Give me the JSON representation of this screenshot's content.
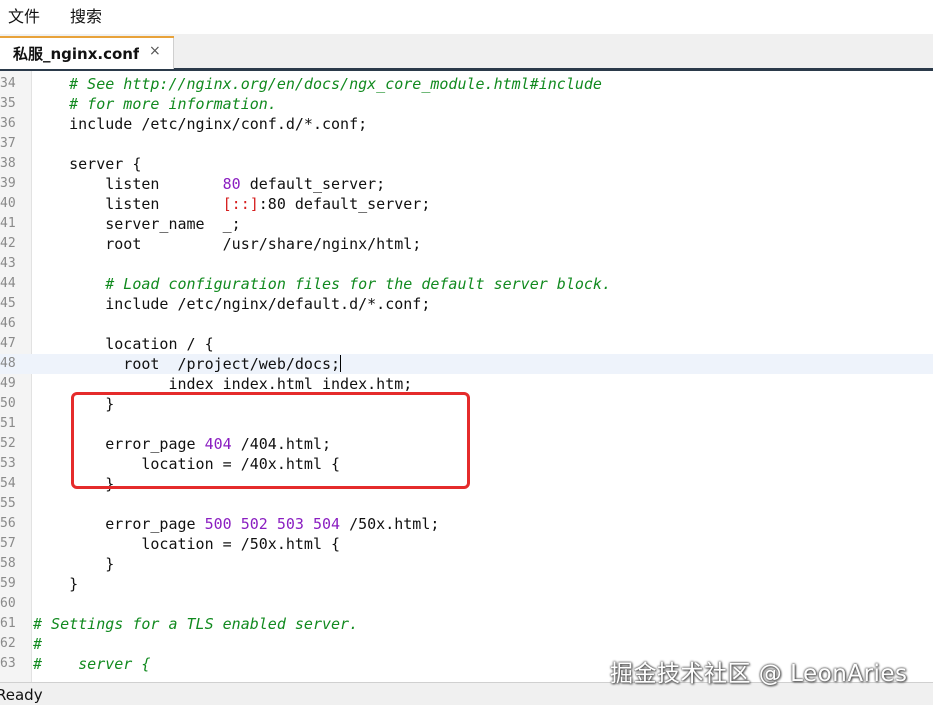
{
  "menubar": {
    "items": [
      "文件",
      "搜索"
    ]
  },
  "tabs": [
    {
      "label": "私服_nginx.conf",
      "close": "×"
    }
  ],
  "editor": {
    "lines": [
      {
        "n": "34",
        "segs": [
          {
            "t": "    "
          },
          {
            "t": "# See http://nginx.org/en/docs/ngx_core_module.html#include",
            "c": "cmt"
          }
        ]
      },
      {
        "n": "35",
        "segs": [
          {
            "t": "    "
          },
          {
            "t": "# for more information.",
            "c": "cmt"
          }
        ]
      },
      {
        "n": "36",
        "segs": [
          {
            "t": "    include /etc/nginx/conf.d/*.conf;"
          }
        ]
      },
      {
        "n": "37",
        "segs": []
      },
      {
        "n": "38",
        "segs": [
          {
            "t": "    server {"
          }
        ]
      },
      {
        "n": "39",
        "segs": [
          {
            "t": "        listen       "
          },
          {
            "t": "80",
            "c": "num"
          },
          {
            "t": " default_server;"
          }
        ]
      },
      {
        "n": "40",
        "segs": [
          {
            "t": "        listen       "
          },
          {
            "t": "[::]",
            "c": "br"
          },
          {
            "t": ":80 default_server;"
          }
        ]
      },
      {
        "n": "41",
        "segs": [
          {
            "t": "        server_name  _;"
          }
        ]
      },
      {
        "n": "42",
        "segs": [
          {
            "t": "        root         /usr/share/nginx/html;"
          }
        ]
      },
      {
        "n": "43",
        "segs": []
      },
      {
        "n": "44",
        "segs": [
          {
            "t": "        "
          },
          {
            "t": "# Load configuration files for the default server block.",
            "c": "cmt"
          }
        ]
      },
      {
        "n": "45",
        "segs": [
          {
            "t": "        include /etc/nginx/default.d/*.conf;"
          }
        ]
      },
      {
        "n": "46",
        "segs": []
      },
      {
        "n": "47",
        "segs": [
          {
            "t": "        location / {"
          }
        ]
      },
      {
        "n": "48",
        "current": true,
        "caret": true,
        "segs": [
          {
            "t": "          root  /project/web/docs;"
          }
        ]
      },
      {
        "n": "49",
        "segs": [
          {
            "t": "               index index.html index.htm;"
          }
        ]
      },
      {
        "n": "50",
        "segs": [
          {
            "t": "        }"
          }
        ]
      },
      {
        "n": "51",
        "segs": []
      },
      {
        "n": "52",
        "segs": [
          {
            "t": "        error_page "
          },
          {
            "t": "404",
            "c": "num"
          },
          {
            "t": " /404.html;"
          }
        ]
      },
      {
        "n": "53",
        "segs": [
          {
            "t": "            location = /40x.html {"
          }
        ]
      },
      {
        "n": "54",
        "segs": [
          {
            "t": "        }"
          }
        ]
      },
      {
        "n": "55",
        "segs": []
      },
      {
        "n": "56",
        "segs": [
          {
            "t": "        error_page "
          },
          {
            "t": "500",
            "c": "num"
          },
          {
            "t": " "
          },
          {
            "t": "502",
            "c": "num"
          },
          {
            "t": " "
          },
          {
            "t": "503",
            "c": "num"
          },
          {
            "t": " "
          },
          {
            "t": "504",
            "c": "num"
          },
          {
            "t": " /50x.html;"
          }
        ]
      },
      {
        "n": "57",
        "segs": [
          {
            "t": "            location = /50x.html {"
          }
        ]
      },
      {
        "n": "58",
        "segs": [
          {
            "t": "        }"
          }
        ]
      },
      {
        "n": "59",
        "segs": [
          {
            "t": "    }"
          }
        ]
      },
      {
        "n": "60",
        "segs": []
      },
      {
        "n": "61",
        "segs": [
          {
            "t": "# Settings for a TLS enabled server.",
            "c": "cmt"
          }
        ]
      },
      {
        "n": "62",
        "segs": [
          {
            "t": "#",
            "c": "cmt"
          }
        ]
      },
      {
        "n": "63",
        "segs": [
          {
            "t": "#    server {",
            "c": "cmt"
          }
        ]
      }
    ]
  },
  "status": {
    "text": "Ready"
  },
  "watermark": "掘金技术社区 @ LeonAries",
  "colors": {
    "comment": "#118a1f",
    "number": "#8a1ec1",
    "bracket": "#d62020",
    "highlight_box": "#e52b2b",
    "tab_accent": "#e8a23a",
    "current_line": "#eef3fb"
  }
}
